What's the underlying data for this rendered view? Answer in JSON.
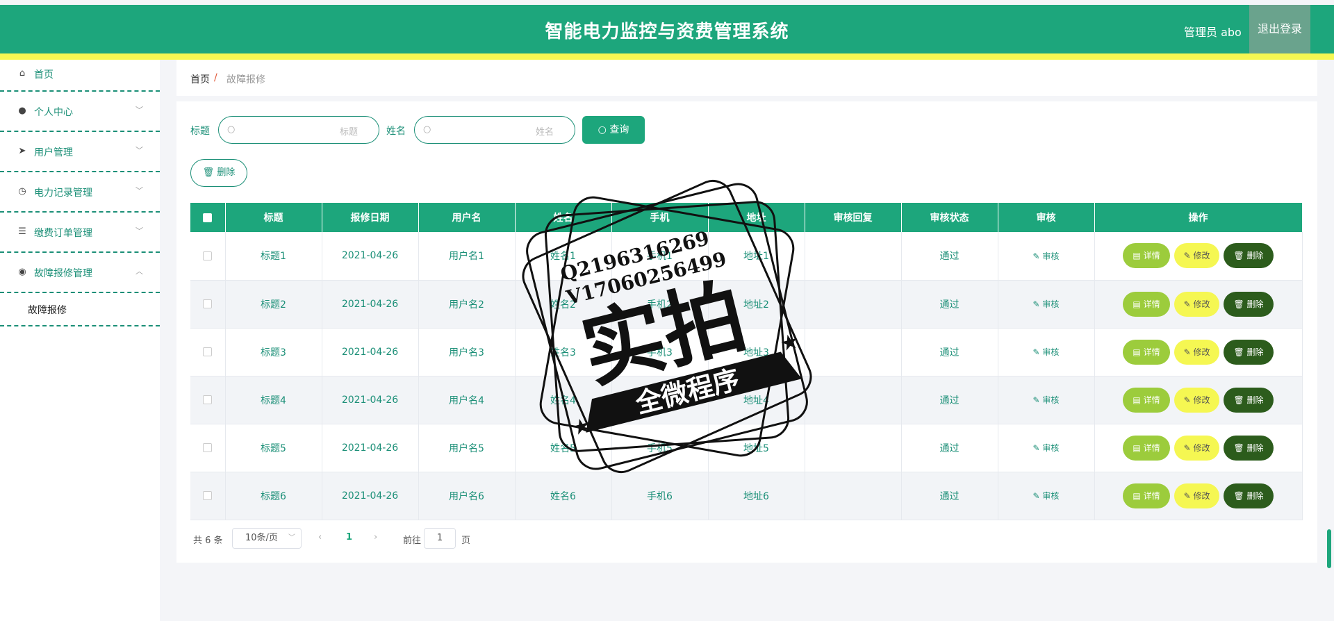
{
  "header": {
    "title": "智能电力监控与资费管理系统",
    "admin_label": "管理员 abo",
    "logout_label": "退出登录"
  },
  "sidebar": {
    "items": [
      {
        "label": "首页",
        "icon": "home-icon"
      },
      {
        "label": "个人中心",
        "icon": "user-icon"
      },
      {
        "label": "用户管理",
        "icon": "send-icon"
      },
      {
        "label": "电力记录管理",
        "icon": "clock-icon"
      },
      {
        "label": "缴费订单管理",
        "icon": "list-icon"
      },
      {
        "label": "故障报修管理",
        "icon": "location-icon"
      }
    ],
    "sub_item": "故障报修"
  },
  "breadcrumb": {
    "home": "首页",
    "sep": "/",
    "current": "故障报修"
  },
  "search": {
    "title_label": "标题",
    "title_placeholder": "标题",
    "name_label": "姓名",
    "name_placeholder": "姓名",
    "query_label": "查询"
  },
  "toolbar": {
    "delete_label": "删除"
  },
  "table": {
    "headers": [
      "标题",
      "报修日期",
      "用户名",
      "姓名",
      "手机",
      "地址",
      "审核回复",
      "审核状态",
      "审核",
      "操作"
    ],
    "rows": [
      {
        "title": "标题1",
        "date": "2021-04-26",
        "username": "用户名1",
        "name": "姓名1",
        "phone": "手机1",
        "address": "地址1",
        "reply": "",
        "status": "通过"
      },
      {
        "title": "标题2",
        "date": "2021-04-26",
        "username": "用户名2",
        "name": "姓名2",
        "phone": "手机2",
        "address": "地址2",
        "reply": "",
        "status": "通过"
      },
      {
        "title": "标题3",
        "date": "2021-04-26",
        "username": "用户名3",
        "name": "姓名3",
        "phone": "手机3",
        "address": "地址3",
        "reply": "",
        "status": "通过"
      },
      {
        "title": "标题4",
        "date": "2021-04-26",
        "username": "用户名4",
        "name": "姓名4",
        "phone": "手机4",
        "address": "地址4",
        "reply": "",
        "status": "通过"
      },
      {
        "title": "标题5",
        "date": "2021-04-26",
        "username": "用户名5",
        "name": "姓名5",
        "phone": "手机5",
        "address": "地址5",
        "reply": "",
        "status": "通过"
      },
      {
        "title": "标题6",
        "date": "2021-04-26",
        "username": "用户名6",
        "name": "姓名6",
        "phone": "手机6",
        "address": "地址6",
        "reply": "",
        "status": "通过"
      }
    ],
    "audit_label": "审核",
    "detail_label": "详情",
    "edit_label": "修改",
    "remove_label": "删除"
  },
  "pagination": {
    "total": "共 6 条",
    "page_size": "10条/页",
    "current_page": "1",
    "goto_label": "前往",
    "goto_value": "1",
    "page_suffix": "页"
  },
  "watermark": {
    "qq": "Q2196316269",
    "vx": "V17060256499",
    "main": "实拍",
    "sub": "全微程序"
  },
  "colors": {
    "primary": "#1da67c",
    "accent_yellow": "#f5f752",
    "detail_green": "#9ccc3c",
    "delete_dark": "#2c5c1c"
  }
}
